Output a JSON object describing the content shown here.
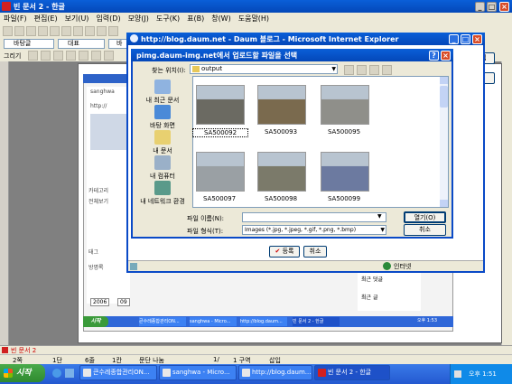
{
  "hwp": {
    "title": "빈 문서 2 - 한글",
    "menu": [
      "파일(F)",
      "편집(E)",
      "보기(U)",
      "입력(D)",
      "모양(J)",
      "도구(K)",
      "표(B)",
      "창(W)",
      "도움말(H)"
    ],
    "style_select": "바탕글",
    "font_select": "대표",
    "font_select2": "바",
    "font_face": "바탕",
    "draw_label": "그리기",
    "doc_tab": "빈 문서 2",
    "right_button1": "글 편집",
    "right_button2": "삭제",
    "status": {
      "page": "2쪽",
      "section": "1단",
      "line": "6줄",
      "col": "1칸",
      "break": "문단 나눔",
      "pos": "1/",
      "sect": "1 구역",
      "mode": "삽입"
    }
  },
  "ie": {
    "title": "http://blog.daum.net - Daum 블로그 - Microsoft Internet Explorer",
    "register": "등록",
    "cancel": "취소",
    "zone": "인터넷"
  },
  "dialog": {
    "title": "pimg.daum-img.net에서 업로드할 파일을 선택",
    "lookin_label": "찾는 위치(I):",
    "lookin_value": "output",
    "places": [
      {
        "label": "내 최근 문서",
        "icon": "recent-documents-icon"
      },
      {
        "label": "바탕 화면",
        "icon": "desktop-icon"
      },
      {
        "label": "내 문서",
        "icon": "my-documents-icon"
      },
      {
        "label": "내 컴퓨터",
        "icon": "my-computer-icon"
      },
      {
        "label": "내 네트워크 환경",
        "icon": "network-icon"
      }
    ],
    "files": [
      {
        "name": "SA500092",
        "color": "#6b6a62"
      },
      {
        "name": "SA500093",
        "color": "#7a6a4e"
      },
      {
        "name": "SA500095",
        "color": "#8f8f8a"
      },
      {
        "name": "SA500097",
        "color": "#9aa0a4"
      },
      {
        "name": "SA500098",
        "color": "#7b7a6a"
      },
      {
        "name": "SA500099",
        "color": "#6c7aa0"
      }
    ],
    "filename_label": "파일 이름(N):",
    "filename_value": "",
    "filetype_label": "파일 형식(T):",
    "filetype_value": "Images (*.jpg, *.jpeg, *.gif, *.png, *.bmp)",
    "open_button": "열기(O)",
    "cancel_button": "취소"
  },
  "inner_taskbar": {
    "start": "시작",
    "items": [
      "큰수레종합관리ON...",
      "sanghwa - Micro...",
      "http://blog.daum...",
      "빈 문서 2 - 한글"
    ],
    "clock": "오후 1:53"
  },
  "taskbar": {
    "start": "시작",
    "items": [
      "큰수레종합관리ON...",
      "sanghwa - Micro...",
      "http://blog.daum....",
      "빈 문서 2 - 한글"
    ],
    "clock": "오후 1:51"
  },
  "blog": {
    "side_texts": [
      "sanghwa",
      "http://",
      "카테고리",
      "전체보기",
      "태그",
      "방명록"
    ],
    "year": "2006",
    "month": "09",
    "right_texts": [
      "최근 덧글",
      "최근 글"
    ]
  }
}
